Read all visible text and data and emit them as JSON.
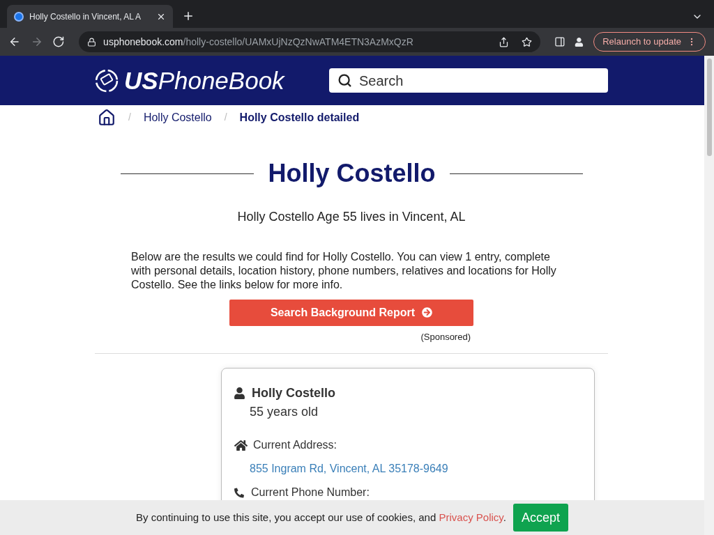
{
  "browser": {
    "tab": {
      "title": "Holly Costello in Vincent, AL A"
    },
    "nav_buttons": [
      {
        "kind": "back",
        "disabled": false
      },
      {
        "kind": "forward",
        "disabled": true
      },
      {
        "kind": "reload",
        "disabled": false
      }
    ],
    "url": {
      "domain": "usphonebook.com",
      "path": "/holly-costello/UAMxUjNzQzNwATM4ETN3AzMxQzR"
    },
    "relaunch_label": "Relaunch to update"
  },
  "header": {
    "logo": {
      "bold": "US",
      "rest": "PhoneBook"
    },
    "search": {
      "placeholder": "Search"
    }
  },
  "breadcrumbs": [
    {
      "separator": "/",
      "label": "Holly Costello",
      "current": false
    },
    {
      "separator": "/",
      "label": "Holly Costello detailed",
      "current": true
    }
  ],
  "title": "Holly Costello",
  "subtitle": "Holly Costello Age 55 lives in Vincent, AL",
  "intro": "Below are the results we could find for Holly Costello. You can view 1 entry, complete with personal details, location history, phone numbers, relatives and locations for Holly Costello. See the links below for more info.",
  "cta": {
    "label": "Search Background Report",
    "note": "(Sponsored)"
  },
  "card": {
    "name": "Holly Costello",
    "age": "55 years old",
    "address_label": "Current Address:",
    "address": "855 Ingram Rd, Vincent, AL 35178-9649",
    "phone_label": "Current Phone Number:"
  },
  "cookie_bar": {
    "text": "By continuing to use this site, you accept our use of cookies, and",
    "link": "Privacy Policy",
    "suffix": ".",
    "accept": "Accept"
  }
}
